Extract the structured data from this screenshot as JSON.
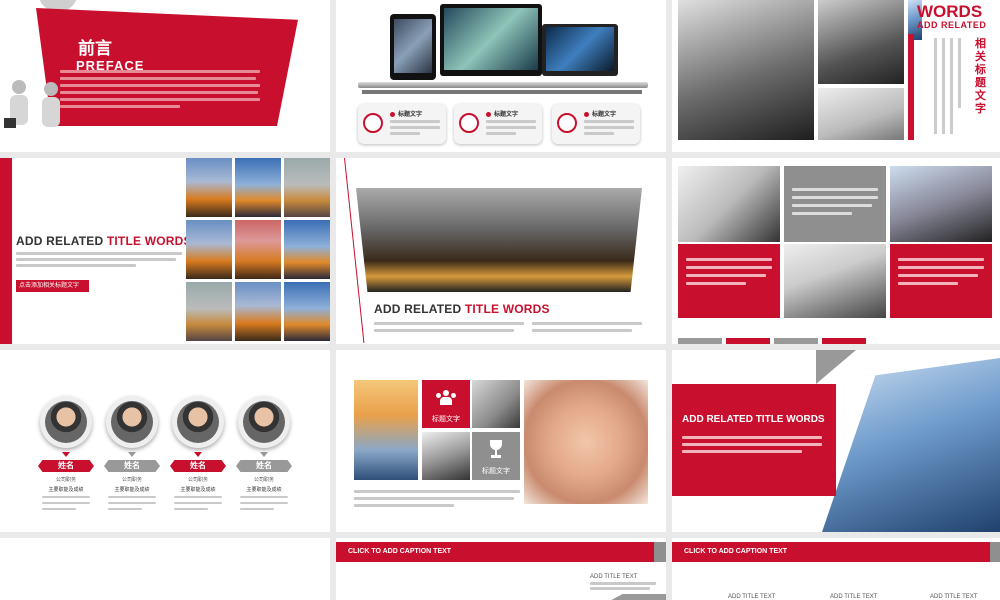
{
  "colors": {
    "accent": "#c8102e",
    "grey": "#9e9e9e",
    "dark": "#333333"
  },
  "s1": {
    "title_cn": "前言",
    "title_en": "PREFACE"
  },
  "s2": {
    "cards": [
      {
        "icon": "pin-icon",
        "label": "标题文字"
      },
      {
        "icon": "chat-icon",
        "label": "标题文字"
      },
      {
        "icon": "cup-icon",
        "label": "标题文字"
      }
    ]
  },
  "s3": {
    "title_en": "WORDS",
    "subtitle_en": "ADD RELATED",
    "title_cn": "相关标题文字"
  },
  "s4": {
    "title_black": "ADD RELATED ",
    "title_red": "TITLE WORDS",
    "button": "点击添加相关标题文字"
  },
  "s5": {
    "title_black": "ADD RELATED ",
    "title_red": "TITLE WORDS"
  },
  "s7": {
    "people": [
      {
        "name": "姓名",
        "role": "公司职务",
        "desc": "主要职能及成绩"
      },
      {
        "name": "姓名",
        "role": "公司职务",
        "desc": "主要职能及成绩"
      },
      {
        "name": "姓名",
        "role": "公司职务",
        "desc": "主要职能及成绩"
      },
      {
        "name": "姓名",
        "role": "公司职务",
        "desc": "主要职能及成绩"
      }
    ]
  },
  "s8": {
    "tile1": "标题文字",
    "tile2": "标题文字"
  },
  "s9": {
    "title": "ADD RELATED TITLE WORDS"
  },
  "s11": {
    "caption": "CLICK TO ADD CAPTION TEXT",
    "sub": "ADD TITLE TEXT"
  },
  "s12": {
    "caption": "CLICK TO ADD CAPTION TEXT",
    "subs": [
      "ADD TITLE TEXT",
      "ADD TITLE TEXT",
      "ADD TITLE TEXT"
    ]
  }
}
